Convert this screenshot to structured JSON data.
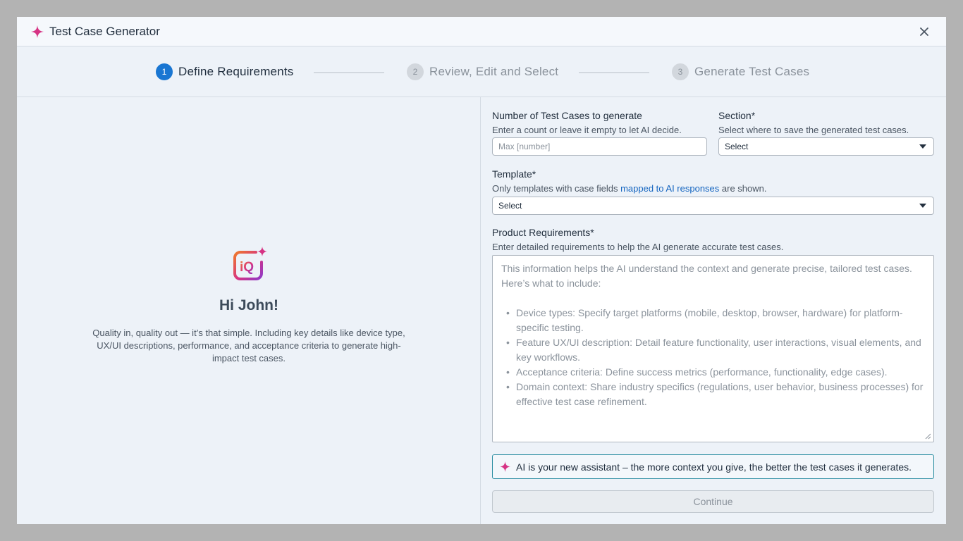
{
  "dialog": {
    "title": "Test Case Generator"
  },
  "stepper": {
    "steps": [
      {
        "number": "1",
        "label": "Define Requirements",
        "state": "active"
      },
      {
        "number": "2",
        "label": "Review, Edit and Select",
        "state": "inactive"
      },
      {
        "number": "3",
        "label": "Generate Test Cases",
        "state": "inactive"
      }
    ]
  },
  "welcome": {
    "greeting": "Hi John!",
    "description": "Quality in, quality out — it’s that simple. Including key details like device type, UX/UI descriptions, performance, and acceptance criteria to generate high-impact test cases.",
    "logo_icon": "testrail-iq-logo-icon"
  },
  "form": {
    "count": {
      "label": "Number of Test Cases to generate",
      "help": "Enter a count or leave it empty to let AI decide.",
      "placeholder": "Max [number]",
      "value": ""
    },
    "section": {
      "label": "Section*",
      "help": "Select where to save the generated test cases.",
      "value": "Select"
    },
    "template": {
      "label": "Template*",
      "help_before": "Only templates with case fields ",
      "help_link": "mapped to AI responses",
      "help_after": " are shown.",
      "value": "Select"
    },
    "requirements": {
      "label": "Product Requirements*",
      "help": "Enter detailed requirements to help the AI generate accurate test cases.",
      "placeholder_intro": "This information helps the AI understand the context and generate precise, tailored test cases. Here’s what to include:",
      "placeholder_items": [
        "Device types: Specify target platforms (mobile, desktop, browser, hardware) for platform-specific testing.",
        "Feature UX/UI description: Detail feature functionality, user interactions, visual elements, and key workflows.",
        "Acceptance criteria: Define success metrics (performance, functionality, edge cases).",
        "Domain context: Share industry specifics (regulations, user behavior, business processes) for effective test case refinement."
      ]
    },
    "ai_tip": "AI is your new assistant – the more context you give, the better the test cases it generates.",
    "continue_label": "Continue"
  },
  "colors": {
    "accent": "#1976d2",
    "sparkle": "#d63384",
    "tip_border": "#2e8fa3",
    "link": "#1565c0"
  }
}
